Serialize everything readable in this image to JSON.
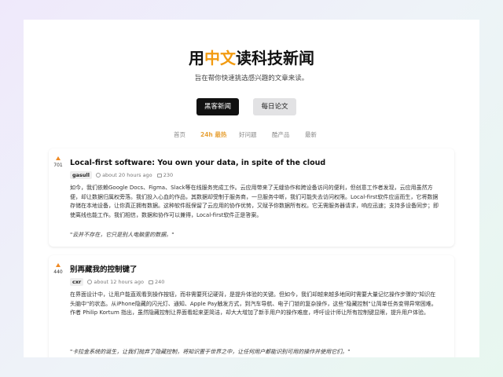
{
  "header": {
    "title_prefix": "用",
    "title_accent": "中文",
    "title_suffix": "读科技新闻",
    "tagline": "旨在帮你快速挑选感兴趣的文章来读。"
  },
  "colors": {
    "accent": "#f29b11",
    "filter_active": "#e8a33a",
    "upvote": "#f08a24"
  },
  "source_buttons": {
    "hn": "黑客新闻",
    "papers": "每日论文"
  },
  "filters": [
    "首页",
    "24h 最热",
    "好问题",
    "酷产品",
    "最新"
  ],
  "active_filter": "24h 最热",
  "stories": [
    {
      "score": "701",
      "title": "Local-first software: You own your data, in spite of the cloud",
      "author": "gasull",
      "time": "about 20 hours ago",
      "comments": "230",
      "summary": "如今，我们依赖Google Docs、Figma、Slack等在线服务完成工作。云应用带来了无缝协作和跨设备访问的便利，但创意工作者发现，云应用虽然方便，却让数据归属权旁落。我们投入心血的作品，其数据却受制于服务商，一旦服务中断，我们可能失去访问权限。Local-first软件应运而生，它将数据存储在本地设备，让你真正拥有数据。这种软件既保留了云应用的协作优势，又赋予你数据所有权。它无需服务器请求，响应迅速；支持多设备同步；即使离线也能工作。我们相信，数据和协作可以兼得，Local-first软件正是答案。",
      "quote": "\"云并不存在，它只是别人电脑里的数据。\""
    },
    {
      "score": "440",
      "title": "别再藏我的控制键了",
      "author": "cxr",
      "time": "about 12 hours ago",
      "comments": "240",
      "summary": "在界面设计中，让用户能直观看到操作按钮，而非需要死记硬背，是提升体验的关键。但如今，我们却越来越多地同时需要大量记忆操作步骤的\"知识在头脑中\"的状态。从iPhone隐藏的闪光灯、通知、Apple Pay触发方式，到汽车导航、电子门锁的复杂操作，这些\"隐藏控制\"让简单任务变得异常困难。作者 Philip Kortum 指出，虽然隐藏控制让界面看起来更简洁，却大大增加了新手用户的操作难度，呼吁设计师让所有控制键显眼，提升用户体验。",
      "quote": "\"卡拉金系统的诞生，让我们抛弃了隐藏控制，将知识置于世界之中，让任何用户都能识别可用的操作并使用它们。\""
    }
  ]
}
